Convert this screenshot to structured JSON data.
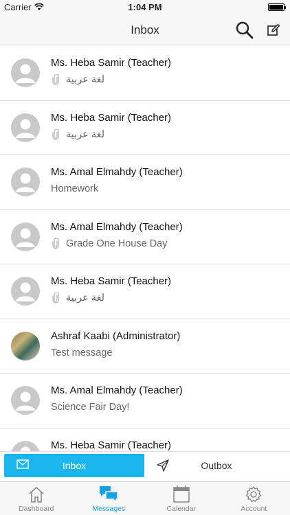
{
  "status": {
    "carrier": "Carrier",
    "time": "1:04 PM",
    "battery_level": 1.0
  },
  "nav": {
    "title": "Inbox",
    "search_icon": "search-icon",
    "compose_icon": "compose-icon"
  },
  "messages": [
    {
      "sender": "Ms. Heba Samir (Teacher)",
      "subject": "لغة عربية",
      "attachment": true,
      "avatar": "placeholder"
    },
    {
      "sender": "Ms. Heba Samir (Teacher)",
      "subject": "لغة عربية",
      "attachment": true,
      "avatar": "placeholder"
    },
    {
      "sender": "Ms. Amal Elmahdy (Teacher)",
      "subject": "Homework",
      "attachment": false,
      "avatar": "placeholder"
    },
    {
      "sender": "Ms. Amal Elmahdy (Teacher)",
      "subject": "Grade One House Day",
      "attachment": true,
      "avatar": "placeholder"
    },
    {
      "sender": "Ms. Heba Samir (Teacher)",
      "subject": "لغة عربية",
      "attachment": true,
      "avatar": "placeholder"
    },
    {
      "sender": "Ashraf Kaabi (Administrator)",
      "subject": "Test message",
      "attachment": false,
      "avatar": "photo"
    },
    {
      "sender": "Ms. Amal Elmahdy (Teacher)",
      "subject": "Science Fair Day!",
      "attachment": false,
      "avatar": "placeholder"
    },
    {
      "sender": "Ms. Heba Samir (Teacher)",
      "subject": "",
      "attachment": false,
      "avatar": "placeholder"
    }
  ],
  "segment": {
    "inbox_label": "Inbox",
    "outbox_label": "Outbox",
    "selected": "inbox"
  },
  "tabs": [
    {
      "label": "Dashboard",
      "icon": "home-icon",
      "active": false
    },
    {
      "label": "Messages",
      "icon": "messages-icon",
      "active": true
    },
    {
      "label": "Calendar",
      "icon": "calendar-icon",
      "active": false
    },
    {
      "label": "Account",
      "icon": "gear-icon",
      "active": false
    }
  ],
  "colors": {
    "accent": "#1ab6ef",
    "active_tab": "#1a9fe0",
    "inactive_tab": "#888888"
  }
}
